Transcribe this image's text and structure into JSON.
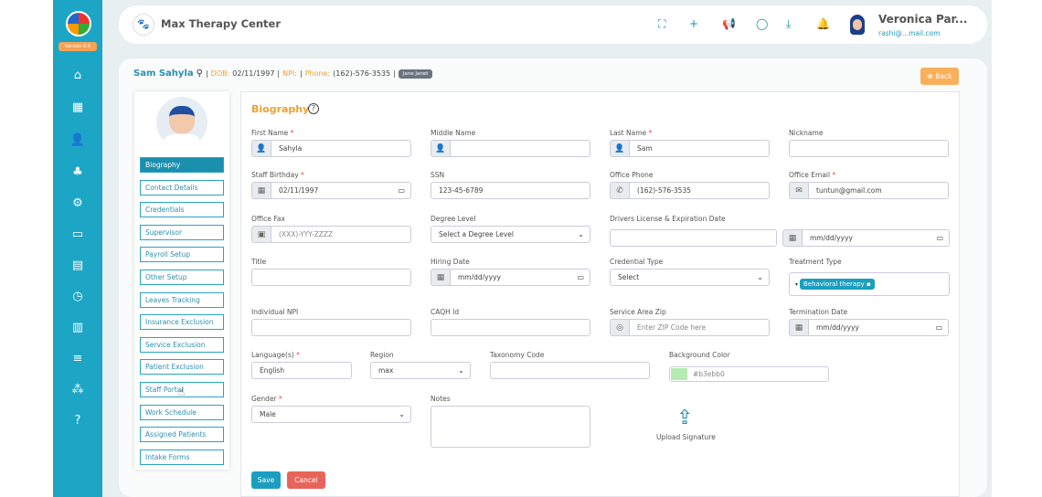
{
  "sidebar": {
    "version": "Version 6.0",
    "icons": [
      "home-icon",
      "calendar-icon",
      "add-user-icon",
      "users-icon",
      "settings-icon",
      "credit-card-icon",
      "document-icon",
      "clock-icon",
      "bar-chart-icon",
      "menu-icon",
      "sitemap-icon",
      "help-icon"
    ]
  },
  "header": {
    "title": "Max Therapy Center",
    "user_name": "Veronica Par...",
    "user_email": "rashi@...mail.com"
  },
  "patient": {
    "name": "Sam Sahyla",
    "dob_label": "DOB:",
    "dob": "02/11/1997",
    "npi_label": "NPI:",
    "phone_label": "Phone:",
    "phone": "(162)-576-3535",
    "badge": "Jane Janet",
    "back": "Back"
  },
  "menu": [
    "Biography",
    "Contact Details",
    "Credentials",
    "Supervisor",
    "Payroll Setup",
    "Other Setup",
    "Leaves Tracking",
    "Insurance Exclusion",
    "Service Exclusion",
    "Patient Exclusion",
    "Staff Portal",
    "Work Schedule",
    "Assigned Patients",
    "Intake Forms"
  ],
  "form": {
    "title": "Biography",
    "first_name": {
      "label": "First Name",
      "value": "Sahyla"
    },
    "middle_name": {
      "label": "Middle Name",
      "value": ""
    },
    "last_name": {
      "label": "Last Name",
      "value": "Sam"
    },
    "nickname": {
      "label": "Nickname",
      "value": ""
    },
    "birthday": {
      "label": "Staff Birthday",
      "value": "02/11/1997"
    },
    "ssn": {
      "label": "SSN",
      "value": "123-45-6789"
    },
    "office_phone": {
      "label": "Office Phone",
      "value": "(162)-576-3535"
    },
    "office_email": {
      "label": "Office Email",
      "value": "tuntun@gmail.com"
    },
    "office_fax": {
      "label": "Office Fax",
      "placeholder": "(XXX)-YYY-ZZZZ"
    },
    "degree": {
      "label": "Degree Level",
      "value": "Select a Degree Level"
    },
    "drivers": {
      "label": "Drivers License & Expiration Date",
      "date_placeholder": "mm/dd/yyyy"
    },
    "title_f": {
      "label": "Title"
    },
    "hiring": {
      "label": "Hiring Date",
      "placeholder": "mm/dd/yyyy"
    },
    "credential": {
      "label": "Credential Type",
      "value": "Select"
    },
    "treatment": {
      "label": "Treatment Type",
      "tag": "Behavioral therapy"
    },
    "npi": {
      "label": "Individual NPI"
    },
    "caqh": {
      "label": "CAQH Id"
    },
    "zip": {
      "label": "Service Area Zip",
      "placeholder": "Enter ZIP Code here"
    },
    "termination": {
      "label": "Termination Date",
      "placeholder": "mm/dd/yyyy"
    },
    "language": {
      "label": "Language(s)",
      "value": "English"
    },
    "region": {
      "label": "Region",
      "value": "max"
    },
    "taxonomy": {
      "label": "Taxonomy Code"
    },
    "bgcolor": {
      "label": "Background Color",
      "value": "#b3ebb0"
    },
    "gender": {
      "label": "Gender",
      "value": "Male"
    },
    "notes": {
      "label": "Notes"
    },
    "upload": "Upload Signature",
    "save": "Save",
    "cancel": "Cancel"
  }
}
